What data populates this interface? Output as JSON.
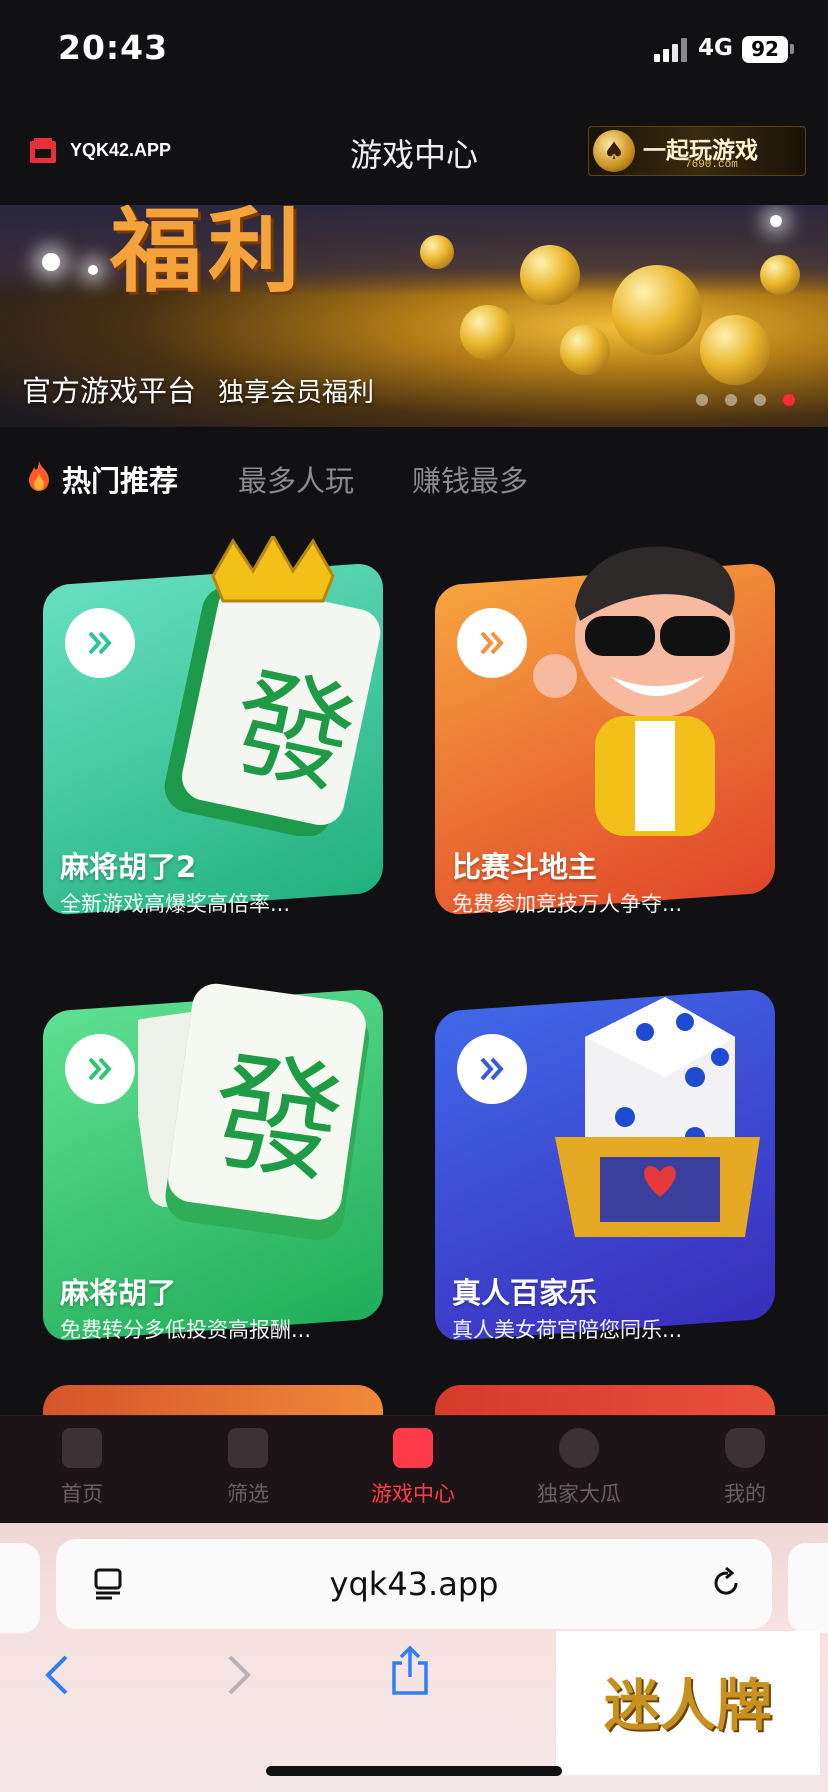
{
  "status_bar": {
    "time": "20:43",
    "network": "4G",
    "battery": "92"
  },
  "header": {
    "brand": "YQK42.APP",
    "title": "游戏中心",
    "ad_text": "一起玩游戏",
    "ad_sub": "7690.com"
  },
  "hero": {
    "caption_main": "官方游戏平台",
    "caption_sub": "独享会员福利",
    "art_text": "福利",
    "slides": 4,
    "active_slide": 4
  },
  "tabs": [
    {
      "label": "热门推荐",
      "active": true
    },
    {
      "label": "最多人玩",
      "active": false
    },
    {
      "label": "赚钱最多",
      "active": false
    }
  ],
  "games": [
    {
      "title": "麻将胡了2",
      "desc": "全新游戏高爆奖高倍率...",
      "color_top": "#5fdcb6",
      "color_bottom": "#1fae7a",
      "arrow": "#2bc59a"
    },
    {
      "title": "比赛斗地主",
      "desc": "免费参加竞技万人争夺...",
      "color_top": "#f59a3d",
      "color_bottom": "#e2482a",
      "arrow": "#f5913b"
    },
    {
      "title": "麻将胡了",
      "desc": "免费转分多低投资高报酬...",
      "color_top": "#56d98a",
      "color_bottom": "#1fae5a",
      "arrow": "#2fc46d"
    },
    {
      "title": "真人百家乐",
      "desc": "真人美女荷官陪您同乐...",
      "color_top": "#3f63e6",
      "color_bottom": "#3a2fbe",
      "arrow": "#3a5be0"
    }
  ],
  "bottom_nav": [
    {
      "label": "首页",
      "icon": "clapperboard-icon",
      "active": false
    },
    {
      "label": "筛选",
      "icon": "filter-icon",
      "active": false
    },
    {
      "label": "游戏中心",
      "icon": "game-card-icon",
      "active": true
    },
    {
      "label": "独家大瓜",
      "icon": "planet-icon",
      "active": false
    },
    {
      "label": "我的",
      "icon": "profile-icon",
      "active": false
    }
  ],
  "browser": {
    "url": "yqk43.app",
    "watermark": "迷人牌"
  }
}
